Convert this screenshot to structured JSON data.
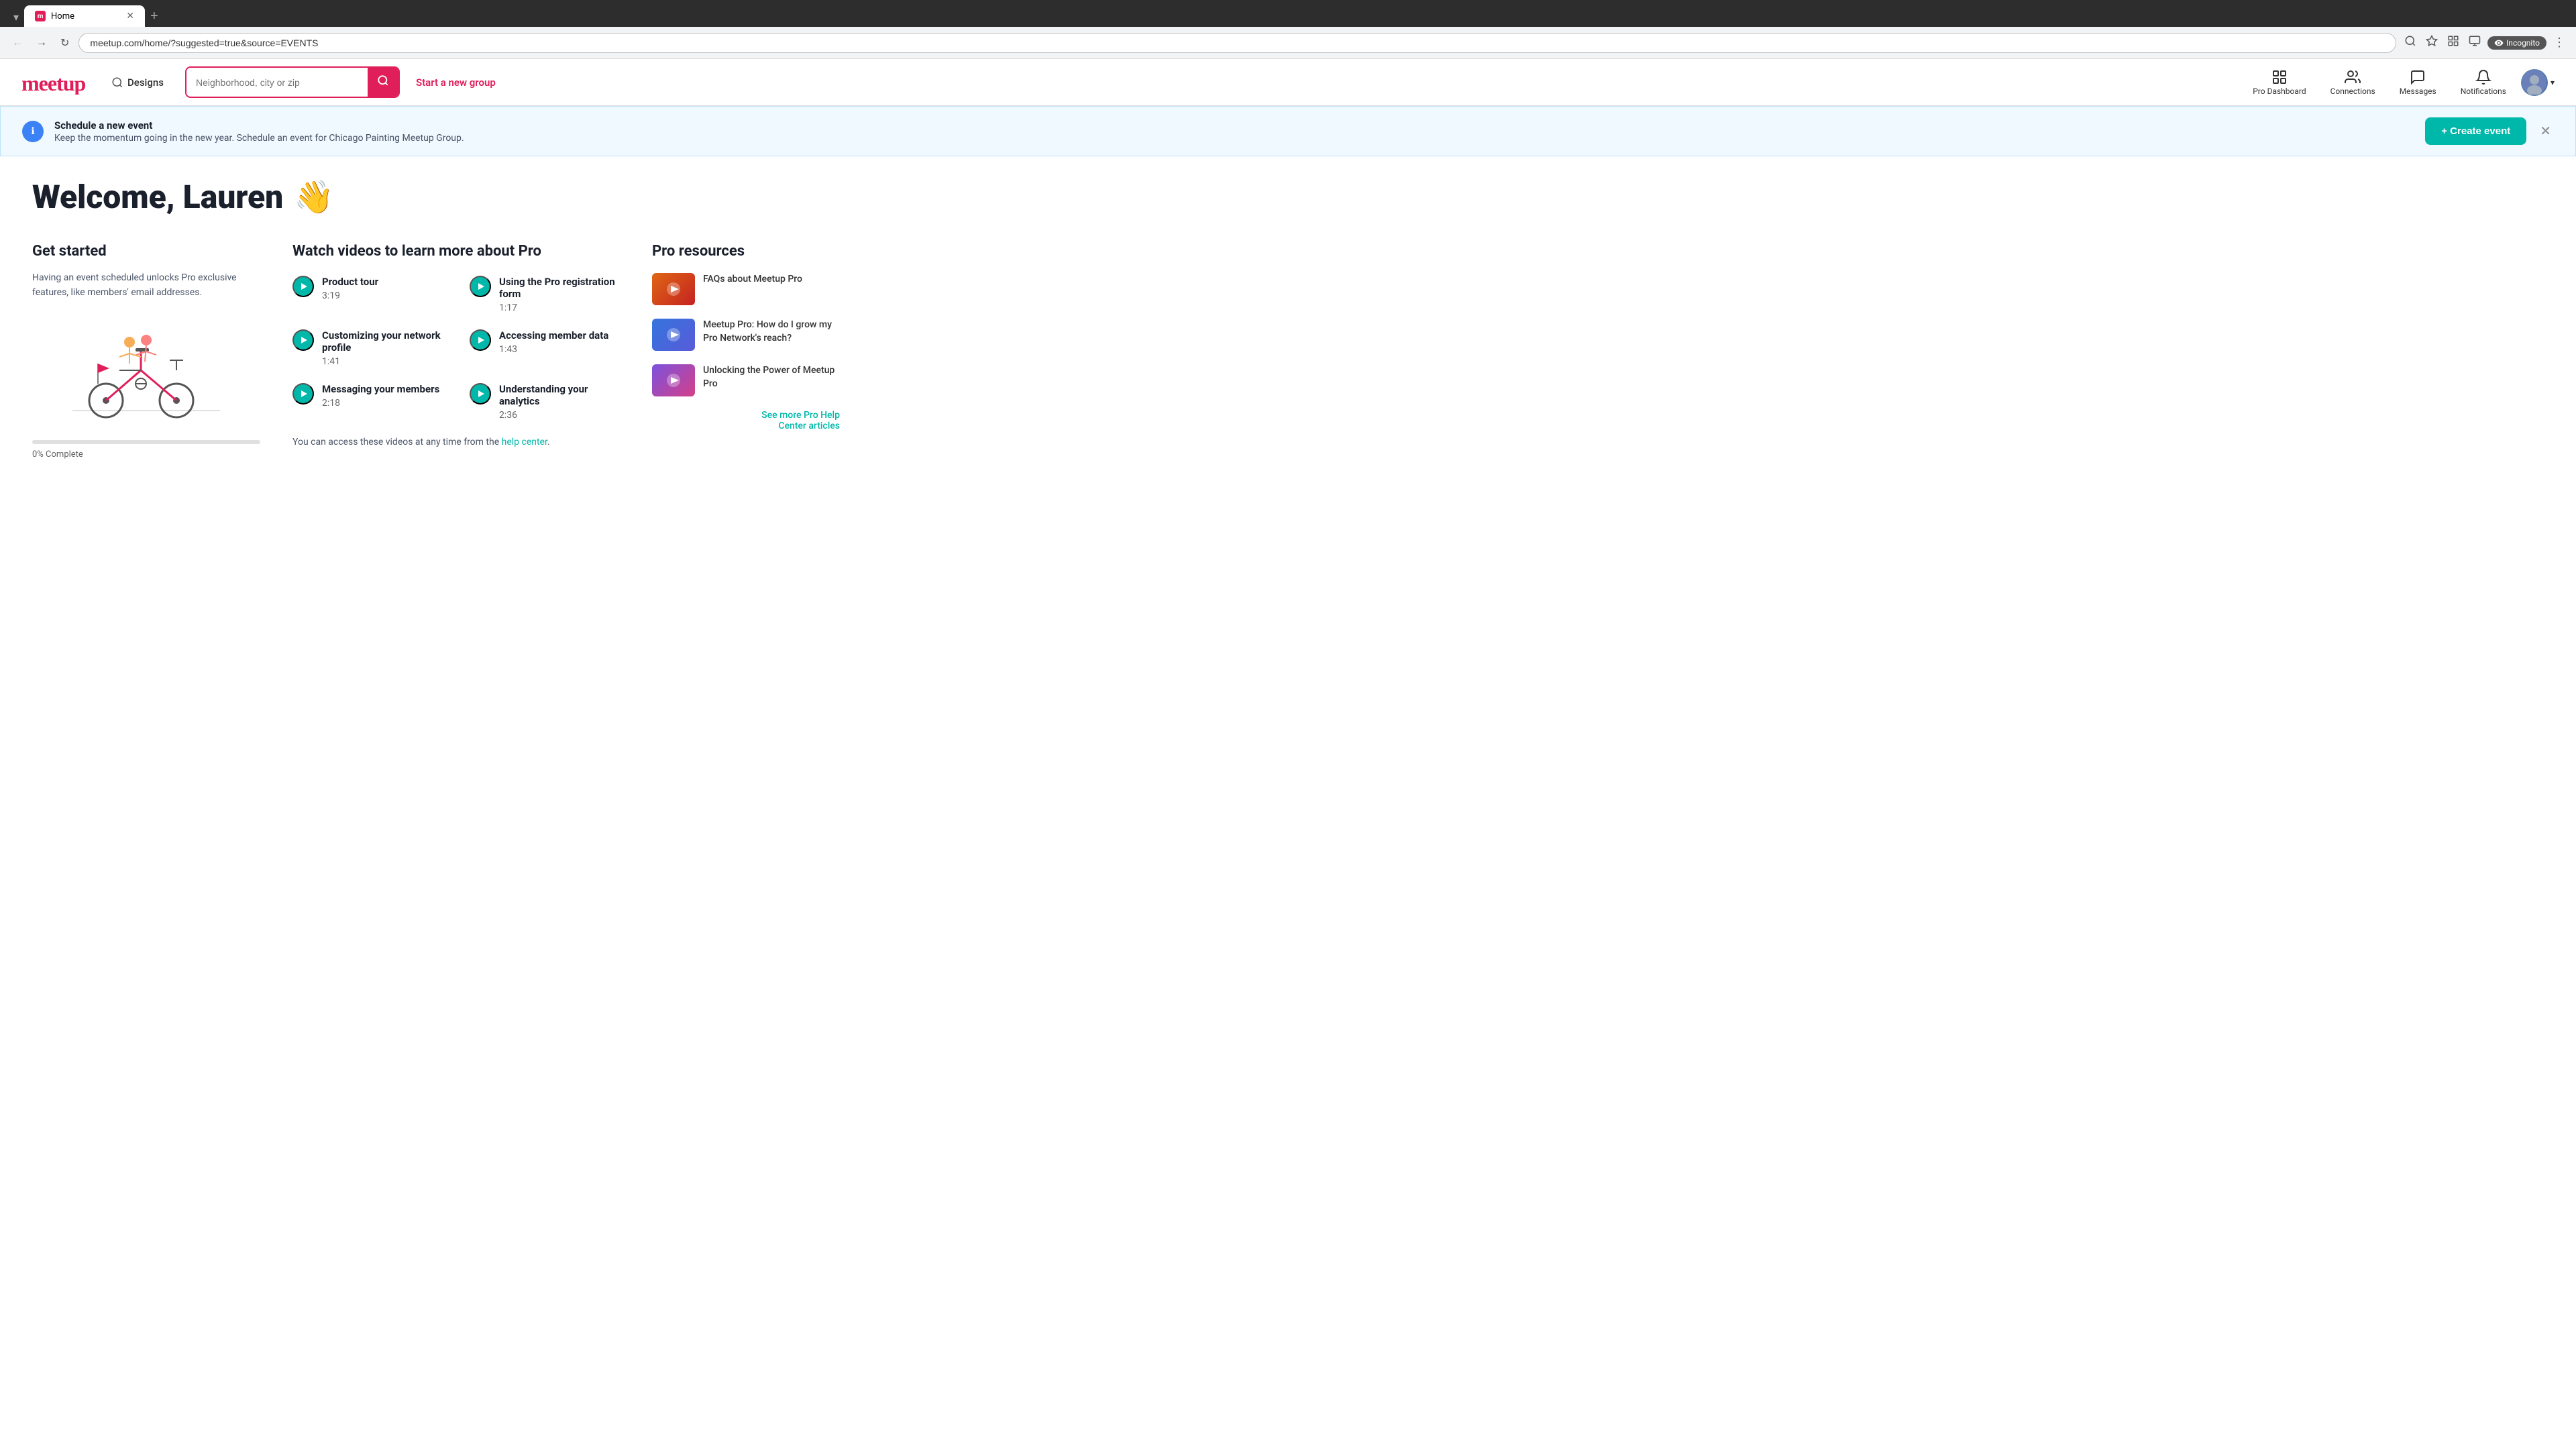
{
  "browser": {
    "tab_label": "Home",
    "tab_favicon": "M",
    "address": "meetup.com/home/?suggested=true&source=EVENTS",
    "incognito_label": "Incognito",
    "new_tab_label": "+"
  },
  "header": {
    "logo_text": "meetup",
    "search_label": "Designs",
    "location_placeholder": "Neighborhood, city or zip",
    "start_new_group": "Start a new group",
    "nav": {
      "pro_dashboard": "Pro Dashboard",
      "connections": "Connections",
      "messages": "Messages",
      "notifications": "Notifications"
    }
  },
  "banner": {
    "title": "Schedule a new event",
    "description": "Keep the momentum going in the new year. Schedule an event for Chicago Painting Meetup Group.",
    "cta_label": "+ Create event"
  },
  "welcome": {
    "heading": "Welcome, Lauren",
    "emoji": "👋"
  },
  "get_started": {
    "title": "Get started",
    "description": "Having an event scheduled unlocks Pro exclusive features, like members' email addresses.",
    "progress_percent": 0,
    "progress_label": "0% Complete"
  },
  "videos": {
    "title": "Watch videos to learn more about Pro",
    "items": [
      {
        "title": "Product tour",
        "duration": "3:19"
      },
      {
        "title": "Using the Pro registration form",
        "duration": "1:17"
      },
      {
        "title": "Customizing your network profile",
        "duration": "1:41"
      },
      {
        "title": "Accessing member data",
        "duration": "1:43"
      },
      {
        "title": "Messaging your members",
        "duration": "2:18"
      },
      {
        "title": "Understanding your analytics",
        "duration": "2:36"
      }
    ],
    "footnote_prefix": "You can access these videos at any time from the ",
    "help_link_label": "help center",
    "footnote_suffix": "."
  },
  "pro_resources": {
    "title": "Pro resources",
    "items": [
      {
        "title": "FAQs about Meetup Pro",
        "thumb_class": "thumb-1"
      },
      {
        "title": "Meetup Pro: How do I grow my Pro Network's reach?",
        "thumb_class": "thumb-2"
      },
      {
        "title": "Unlocking the Power of Meetup Pro",
        "thumb_class": "thumb-3"
      }
    ],
    "see_more_label": "See more Pro Help",
    "center_label": "Center articles"
  }
}
